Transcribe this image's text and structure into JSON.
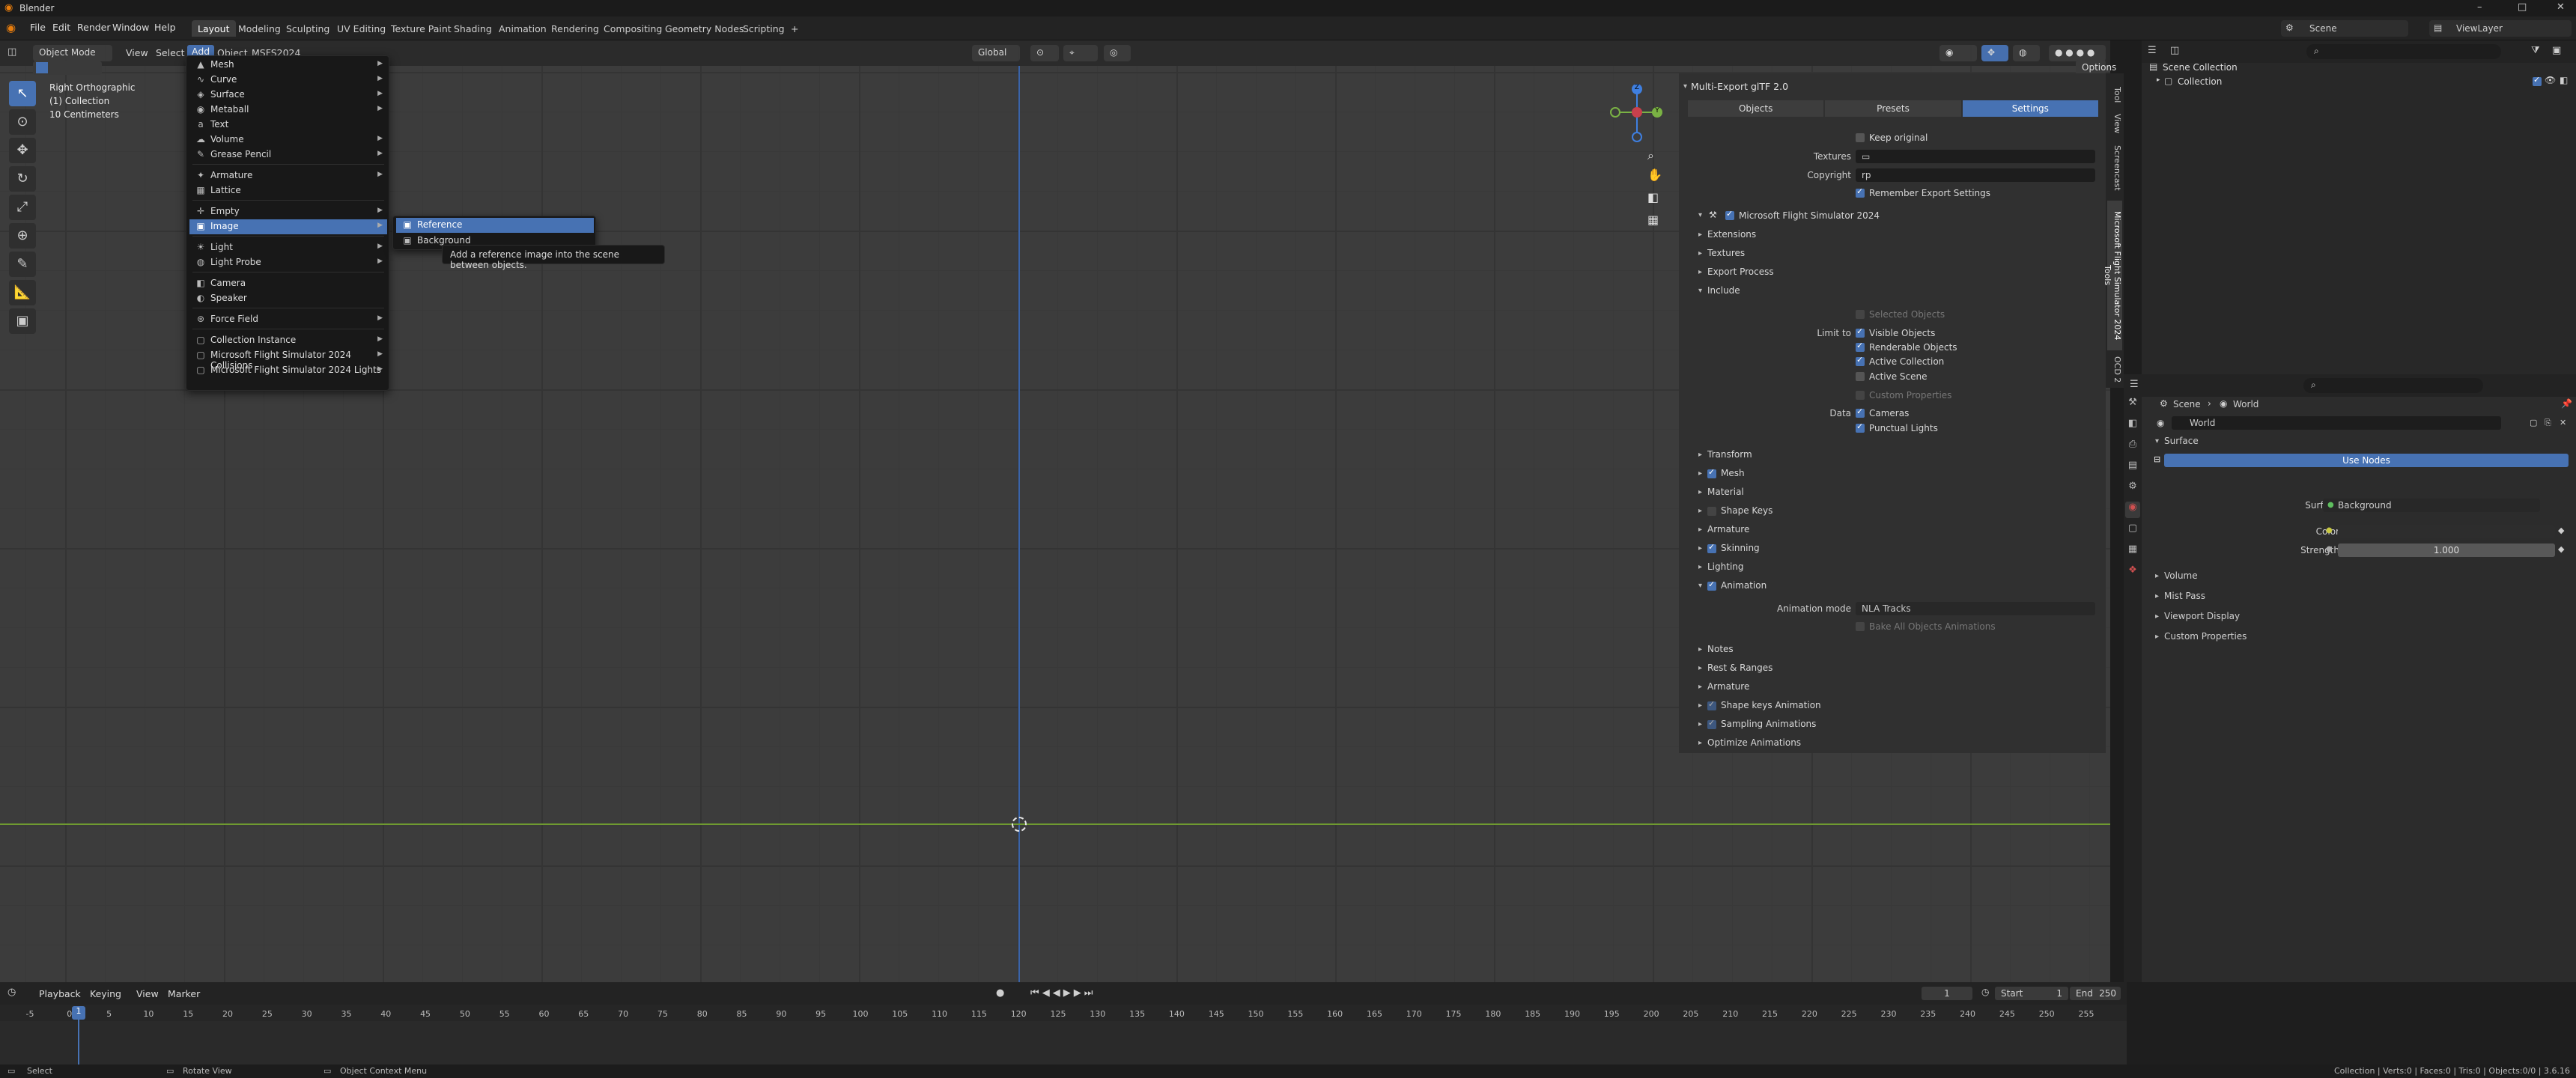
{
  "title": "Blender",
  "window_controls": [
    "–",
    "□",
    "✕"
  ],
  "menu": [
    "File",
    "Edit",
    "Render",
    "Window",
    "Help"
  ],
  "workspaces": [
    "Layout",
    "Modeling",
    "Sculpting",
    "UV Editing",
    "Texture Paint",
    "Shading",
    "Animation",
    "Rendering",
    "Compositing",
    "Geometry Nodes",
    "Scripting"
  ],
  "active_workspace": "Layout",
  "add_tab": "+",
  "scene_name": "Scene",
  "view_layer": "ViewLayer",
  "viewport_header": {
    "mode": "Object Mode",
    "items": [
      "View",
      "Select",
      "Add",
      "Object",
      "MSFS2024"
    ],
    "orientation": "Global",
    "options": "Options"
  },
  "viewport_info": {
    "view": "Right Orthographic",
    "collection": "(1) Collection",
    "scale": "10 Centimeters"
  },
  "gizmo": {
    "y": "Y",
    "z": "Z"
  },
  "add_menu": {
    "items": [
      {
        "label": "Mesh",
        "icon": "mesh-icon",
        "glyph": "▲",
        "arrow": true
      },
      {
        "label": "Curve",
        "icon": "curve-icon",
        "glyph": "∿",
        "arrow": true
      },
      {
        "label": "Surface",
        "icon": "surface-icon",
        "glyph": "◈",
        "arrow": true
      },
      {
        "label": "Metaball",
        "icon": "metaball-icon",
        "glyph": "◉",
        "arrow": true
      },
      {
        "label": "Text",
        "icon": "text-icon",
        "glyph": "a",
        "arrow": false
      },
      {
        "label": "Volume",
        "icon": "volume-icon",
        "glyph": "☁",
        "arrow": true
      },
      {
        "label": "Grease Pencil",
        "icon": "grease-pencil-icon",
        "glyph": "✎",
        "arrow": true
      },
      {
        "label": "Armature",
        "icon": "armature-icon",
        "glyph": "✦",
        "arrow": true
      },
      {
        "label": "Lattice",
        "icon": "lattice-icon",
        "glyph": "▦",
        "arrow": false
      },
      {
        "label": "Empty",
        "icon": "empty-icon",
        "glyph": "✛",
        "arrow": true
      },
      {
        "label": "Image",
        "icon": "image-icon",
        "glyph": "▣",
        "arrow": true
      },
      {
        "label": "Light",
        "icon": "light-icon",
        "glyph": "☀",
        "arrow": true
      },
      {
        "label": "Light Probe",
        "icon": "light-probe-icon",
        "glyph": "◍",
        "arrow": true
      },
      {
        "label": "Camera",
        "icon": "camera-icon",
        "glyph": "◧",
        "arrow": false
      },
      {
        "label": "Speaker",
        "icon": "speaker-icon",
        "glyph": "◐",
        "arrow": false
      },
      {
        "label": "Force Field",
        "icon": "force-field-icon",
        "glyph": "⊛",
        "arrow": true
      },
      {
        "label": "Collection Instance",
        "icon": "collection-instance-icon",
        "glyph": "▢",
        "arrow": true
      },
      {
        "label": "Microsoft Flight Simulator 2024 Collisions",
        "icon": "collisions-icon",
        "glyph": "▢",
        "arrow": true
      },
      {
        "label": "Microsoft Flight Simulator 2024 Lights",
        "icon": "lights-icon",
        "glyph": "▢",
        "arrow": true
      }
    ]
  },
  "image_submenu": [
    "Reference",
    "Background"
  ],
  "tooltip": "Add a reference image into the scene between objects.",
  "npanel": {
    "title": "Multi-Export glTF 2.0",
    "tabs": [
      "Objects",
      "Presets",
      "Settings"
    ],
    "active_tab": "Settings",
    "keep_original": "Keep original",
    "textures_label": "Textures",
    "copyright_label": "Copyright",
    "copyright_value": "rp",
    "remember": "Remember Export Settings",
    "msfs_header": "Microsoft Flight Simulator 2024",
    "sections_top": [
      "Extensions",
      "Textures",
      "Export Process"
    ],
    "include": "Include",
    "selected_objects": "Selected Objects",
    "limit_to": "Limit to",
    "limit_items": [
      "Visible Objects",
      "Renderable Objects",
      "Active Collection",
      "Active Scene"
    ],
    "custom_properties": "Custom Properties",
    "data_label": "Data",
    "data_items": [
      "Cameras",
      "Punctual Lights"
    ],
    "sections_mid": [
      {
        "label": "Transform",
        "check": false
      },
      {
        "label": "Mesh",
        "check": true
      },
      {
        "label": "Material",
        "check": false
      },
      {
        "label": "Shape Keys",
        "check": false
      },
      {
        "label": "Armature",
        "check": false
      },
      {
        "label": "Skinning",
        "check": true
      },
      {
        "label": "Lighting",
        "check": false
      }
    ],
    "animation": "Animation",
    "animation_mode_label": "Animation mode",
    "animation_mode_value": "NLA Tracks",
    "bake_all": "Bake All Objects Animations",
    "sections_bottom": [
      {
        "label": "Notes",
        "check": false
      },
      {
        "label": "Rest & Ranges",
        "check": false
      },
      {
        "label": "Armature",
        "check": false
      },
      {
        "label": "Shape keys Animation",
        "check": true
      },
      {
        "label": "Sampling Animations",
        "check": true
      },
      {
        "label": "Optimize Animations",
        "check": false
      }
    ]
  },
  "vertical_tabs": [
    "Tool",
    "View",
    "Screencast",
    "Microsoft Flight Simulator 2024 Tools",
    "OCD 2"
  ],
  "outliner": {
    "scene_collection": "Scene Collection",
    "collection": "Collection"
  },
  "properties": {
    "breadcrumb_scene": "Scene",
    "breadcrumb_world": "World",
    "world_name": "World",
    "surface_section": "Surface",
    "use_nodes": "Use Nodes",
    "surface_label": "Surface",
    "surface_value": "Background",
    "color_label": "Color",
    "strength_label": "Strength",
    "strength_value": "1.000",
    "sections": [
      "Volume",
      "Mist Pass",
      "Viewport Display",
      "Custom Properties"
    ]
  },
  "timeline": {
    "menus": [
      "Playback",
      "Keying",
      "View",
      "Marker"
    ],
    "current_frame": "1",
    "start_label": "Start",
    "start": "1",
    "end_label": "End",
    "end": "250",
    "ticks": [
      "-5",
      "0",
      "5",
      "10",
      "15",
      "20",
      "25",
      "30",
      "35",
      "40",
      "45",
      "50",
      "55",
      "60",
      "65",
      "70",
      "75",
      "80",
      "85",
      "90",
      "95",
      "100",
      "105",
      "110",
      "115",
      "120",
      "125",
      "130",
      "135",
      "140",
      "145",
      "150",
      "155",
      "160",
      "165",
      "170",
      "175",
      "180",
      "185",
      "190",
      "195",
      "200",
      "205",
      "210",
      "215",
      "220",
      "225",
      "230",
      "235",
      "240",
      "245",
      "250",
      "255"
    ]
  },
  "statusbar": {
    "select": "Select",
    "rotate": "Rotate View",
    "context": "Object Context Menu",
    "stats": "Collection | Verts:0 | Faces:0 | Tris:0 | Objects:0/0 | 3.6.16"
  },
  "colors": {
    "accent": "#4772b3",
    "x_axis": "#c8404c",
    "y_axis": "#7ab244",
    "z_axis": "#3f7fe0"
  }
}
